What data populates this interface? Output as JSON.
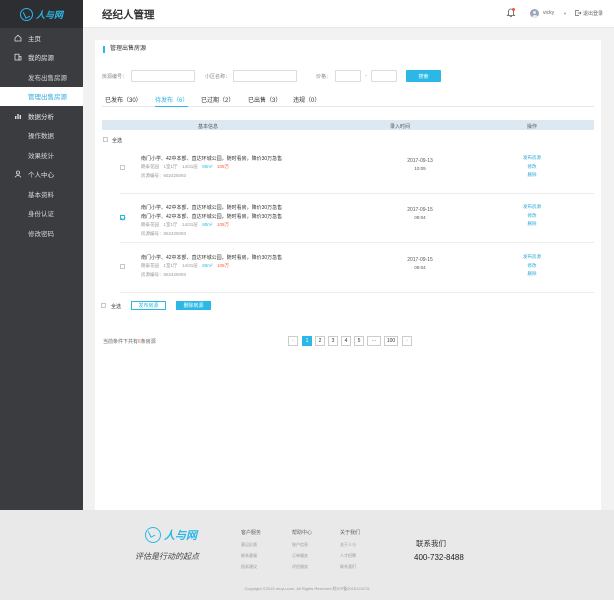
{
  "app": {
    "logo_text": "人与网",
    "header_title": "经纪人管理",
    "user_name": "vicky",
    "logout_label": "退出登录"
  },
  "sidebar": {
    "items": [
      {
        "label": "主页",
        "icon": "home-icon",
        "type": "top"
      },
      {
        "label": "我的房源",
        "icon": "building-icon",
        "type": "top"
      },
      {
        "label": "发布出售房源",
        "type": "sub"
      },
      {
        "label": "管理出售房源",
        "type": "sub",
        "active": true
      },
      {
        "label": "数据分析",
        "icon": "chart-icon",
        "type": "top"
      },
      {
        "label": "操作数据",
        "type": "sub"
      },
      {
        "label": "效果统计",
        "type": "sub"
      },
      {
        "label": "个人中心",
        "icon": "user-icon",
        "type": "top"
      },
      {
        "label": "基本资料",
        "type": "sub"
      },
      {
        "label": "身份认证",
        "type": "sub"
      },
      {
        "label": "修改密码",
        "type": "sub"
      }
    ]
  },
  "panel": {
    "title": "管理出售房源",
    "filters": {
      "house_no_label": "房源编号：",
      "community_label": "小区名称：",
      "price_label": "价格：",
      "price_sep": "-",
      "search_label": "搜索"
    },
    "tabs": [
      {
        "label": "已发布（30）"
      },
      {
        "label": "待发布（6）",
        "active": true
      },
      {
        "label": "已过期（2）"
      },
      {
        "label": "已出售（3）"
      },
      {
        "label": "违规（0）"
      }
    ],
    "table_headers": {
      "info": "基本信息",
      "time": "录入时间",
      "action": "操作"
    },
    "select_all_label": "全选",
    "rows": [
      {
        "checked": false,
        "title1": "南门小学、42中本部、直达环城公园，随时看房，降价30万急售",
        "title2": "",
        "meta_prefix": "朗泰花园　1室1厅　14/31层　",
        "area": "80m²",
        "price": "108万",
        "house_no": "房源编号：652425093",
        "date": "2017-09-13",
        "time": "10:09",
        "actions": [
          "发布房源",
          "修改",
          "删除"
        ]
      },
      {
        "checked": true,
        "title1": "南门小学、42中本部、直达环城公园，随时看房，降价30万急售",
        "title2": "南门小学、42中本部、直达环城公园，随时看房，降价30万急售",
        "meta_prefix": "朗泰花园　1室1厅　14/31层　",
        "area": "80m²",
        "price": "108万",
        "house_no": "房源编号：652425093",
        "date": "2017-09-15",
        "time": "09:04",
        "actions": [
          "发布房源",
          "修改",
          "删除"
        ]
      },
      {
        "checked": false,
        "title1": "南门小学、42中本部、直达环城公园，随时看房，降价30万急售",
        "title2": "",
        "meta_prefix": "朗泰花园　1室1厅　14/31层　",
        "area": "80m²",
        "price": "108万",
        "house_no": "房源编号：652425093",
        "date": "2017-09-15",
        "time": "09:04",
        "actions": [
          "发布房源",
          "修改",
          "删除"
        ]
      }
    ],
    "bottom_actions": {
      "select_all": "全选",
      "publish": "发布房源",
      "delete": "删除房源"
    },
    "pager": {
      "info_prefix": "当前条件下共有",
      "count": "6",
      "info_suffix": "条房源",
      "pages": [
        "1",
        "2",
        "3",
        "4",
        "5",
        "···",
        "100"
      ],
      "current": "1",
      "prev": "‹",
      "next": "›"
    }
  },
  "footer": {
    "logo_text": "人与网",
    "slogan": "评估是行动的起点",
    "columns": [
      {
        "heading": "客户服务",
        "items": [
          "意见反馈",
          "联系客服",
          "投诉建议"
        ]
      },
      {
        "heading": "帮助中心",
        "items": [
          "账户信息",
          "订单服务",
          "评估服务"
        ]
      },
      {
        "heading": "关于我们",
        "items": [
          "关于人与",
          "人才招聘",
          "联系我们"
        ]
      }
    ],
    "contact_heading": "联系我们",
    "phone": "400-732-8488",
    "copyright": "Copyright ©2015 renyu.com, All Rights Reserved 皖ICP备2015124176"
  }
}
